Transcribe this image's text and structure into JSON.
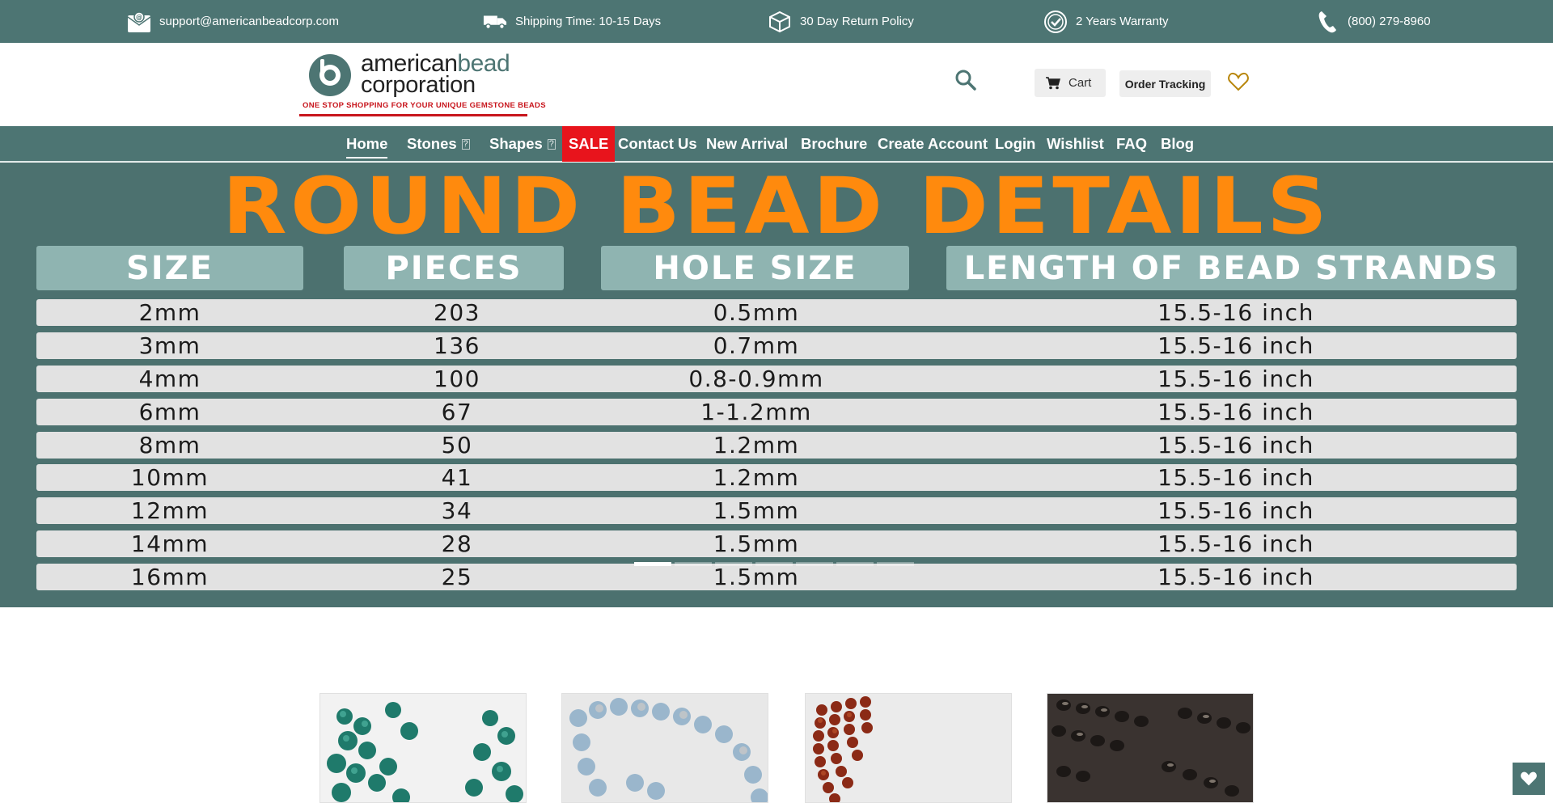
{
  "topbar": {
    "email": "support@americanbeadcorp.com",
    "shipping": "Shipping Time: 10-15 Days",
    "returns": "30 Day Return Policy",
    "warranty": "2 Years Warranty",
    "phone": "(800) 279-8960"
  },
  "logo": {
    "line1_a": "american",
    "line1_b": "bead",
    "line2": "corporation",
    "tagline": "ONE STOP SHOPPING FOR YOUR UNIQUE GEMSTONE BEADS"
  },
  "header": {
    "cart_label": "Cart",
    "order_tracking_label": "Order Tracking"
  },
  "nav": {
    "items": [
      {
        "label": "Home"
      },
      {
        "label": "Stones"
      },
      {
        "label": "Shapes"
      },
      {
        "label": "SALE"
      },
      {
        "label": "Contact Us"
      },
      {
        "label": "New Arrival"
      },
      {
        "label": "Brochure"
      },
      {
        "label": "Create Account"
      },
      {
        "label": "Login"
      },
      {
        "label": "Wishlist"
      },
      {
        "label": "FAQ"
      },
      {
        "label": "Blog"
      }
    ],
    "caret": "?"
  },
  "banner": {
    "title": "ROUND BEAD DETAILS",
    "headers": [
      "SIZE",
      "PIECES",
      "HOLE SIZE",
      "LENGTH OF BEAD STRANDS"
    ],
    "rows": [
      [
        "2mm",
        "203",
        "0.5mm",
        "15.5-16 inch"
      ],
      [
        "3mm",
        "136",
        "0.7mm",
        "15.5-16 inch"
      ],
      [
        "4mm",
        "100",
        "0.8-0.9mm",
        "15.5-16 inch"
      ],
      [
        "6mm",
        "67",
        "1-1.2mm",
        "15.5-16 inch"
      ],
      [
        "8mm",
        "50",
        "1.2mm",
        "15.5-16 inch"
      ],
      [
        "10mm",
        "41",
        "1.2mm",
        "15.5-16 inch"
      ],
      [
        "12mm",
        "34",
        "1.5mm",
        "15.5-16 inch"
      ],
      [
        "14mm",
        "28",
        "1.5mm",
        "15.5-16 inch"
      ],
      [
        "16mm",
        "25",
        "1.5mm",
        "15.5-16 inch"
      ]
    ],
    "slide_count": 7,
    "active_slide": 1
  },
  "products": [
    {
      "name": "green-turquoise-beads"
    },
    {
      "name": "blue-larimar-beads"
    },
    {
      "name": "red-jasper-beads"
    },
    {
      "name": "black-agate-beads"
    }
  ],
  "colors": {
    "brand_teal": "#4d7573",
    "banner_orange": "#ff8a0d",
    "sale_red": "#e8141c",
    "logo_red": "#c8161d"
  }
}
